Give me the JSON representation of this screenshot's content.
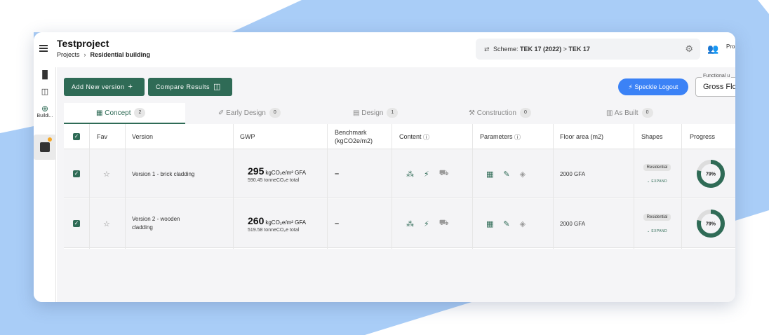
{
  "colors": {
    "accent": "#2f6b56",
    "speckle": "#3b82f6",
    "backdrop": "#a9cdf7"
  },
  "header": {
    "title": "Testproject",
    "breadcrumb": [
      "Projects",
      "Residential building"
    ],
    "scheme_label": "Scheme:",
    "scheme_value": "TEK 17 (2022)",
    "scheme_arrow": ">",
    "scheme_target": "TEK 17",
    "user_label": "Pro"
  },
  "sidebar": {
    "items": [
      {
        "icon": "bar-chart-icon"
      },
      {
        "icon": "compare-icon"
      },
      {
        "icon": "add-circle-icon",
        "label": "Buildi..."
      },
      {
        "icon": "building-thumbnail-icon"
      }
    ]
  },
  "toolbar": {
    "add_label": "Add New version",
    "compare_label": "Compare Results",
    "speckle_label": "Speckle Logout",
    "functional_label": "Functional u",
    "functional_value": "Gross Flo"
  },
  "tabs": [
    {
      "label": "Concept",
      "count": "2",
      "icon": "grid-icon"
    },
    {
      "label": "Early Design",
      "count": "0",
      "icon": "design-icon"
    },
    {
      "label": "Design",
      "count": "1",
      "icon": "design-icon"
    },
    {
      "label": "Construction",
      "count": "0",
      "icon": "construction-icon"
    },
    {
      "label": "As Built",
      "count": "0",
      "icon": "building-icon"
    }
  ],
  "table": {
    "headers": {
      "fav": "Fav",
      "version": "Version",
      "gwp": "GWP",
      "benchmark": "Benchmark (kgCO2e/m2)",
      "content": "Content",
      "parameters": "Parameters",
      "floor": "Floor area (m2)",
      "shapes": "Shapes",
      "progress": "Progress"
    },
    "rows": [
      {
        "version": "Version 1 - brick cladding",
        "gwp": "295",
        "gwp_unit": "kgCO₂e/m² GFA",
        "gwp_total": "590.45 tonneCO₂e total",
        "benchmark": "–",
        "floor": "2000 GFA",
        "shape": "Residential",
        "expand": "⌄ EXPAND",
        "progress": 79,
        "progress_label": "79%"
      },
      {
        "version": "Version 2 - wooden cladding",
        "gwp": "260",
        "gwp_unit": "kgCO₂e/m² GFA",
        "gwp_total": "519.58 tonneCO₂e total",
        "benchmark": "–",
        "floor": "2000 GFA",
        "shape": "Residential",
        "expand": "⌄ EXPAND",
        "progress": 79,
        "progress_label": "79%"
      }
    ]
  }
}
